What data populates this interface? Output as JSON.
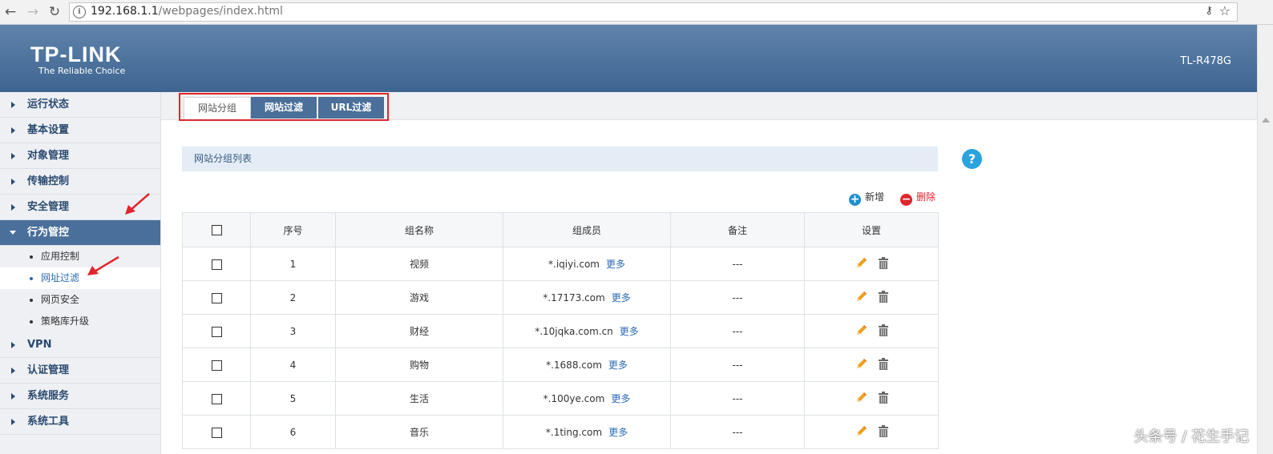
{
  "browser": {
    "url_host": "192.168.1.1",
    "url_path": "/webpages/index.html"
  },
  "header": {
    "logo": "TP-LINK",
    "tagline": "The Reliable Choice",
    "model": "TL-R478G"
  },
  "sidebar": {
    "items": [
      {
        "label": "运行状态"
      },
      {
        "label": "基本设置"
      },
      {
        "label": "对象管理"
      },
      {
        "label": "传输控制"
      },
      {
        "label": "安全管理"
      },
      {
        "label": "行为管控"
      }
    ],
    "subitems": [
      {
        "label": "应用控制"
      },
      {
        "label": "网址过滤"
      },
      {
        "label": "网页安全"
      },
      {
        "label": "策略库升级"
      }
    ],
    "items_after": [
      {
        "label": "VPN"
      },
      {
        "label": "认证管理"
      },
      {
        "label": "系统服务"
      },
      {
        "label": "系统工具"
      }
    ]
  },
  "tabs": [
    {
      "label": "网站分组"
    },
    {
      "label": "网站过滤"
    },
    {
      "label": "URL过滤"
    }
  ],
  "section": {
    "title": "网站分组列表",
    "help": "?",
    "add_label": "新增",
    "delete_label": "删除"
  },
  "table": {
    "headers": [
      "序号",
      "组名称",
      "组成员",
      "备注",
      "设置"
    ],
    "more_label": "更多",
    "rows": [
      {
        "index": "1",
        "name": "视频",
        "member": "*.iqiyi.com",
        "note": "---"
      },
      {
        "index": "2",
        "name": "游戏",
        "member": "*.17173.com",
        "note": "---"
      },
      {
        "index": "3",
        "name": "财经",
        "member": "*.10jqka.com.cn",
        "note": "---"
      },
      {
        "index": "4",
        "name": "购物",
        "member": "*.1688.com",
        "note": "---"
      },
      {
        "index": "5",
        "name": "生活",
        "member": "*.100ye.com",
        "note": "---"
      },
      {
        "index": "6",
        "name": "音乐",
        "member": "*.1ting.com",
        "note": "---"
      }
    ]
  },
  "watermark": "头条号 / 花生手记",
  "colors": {
    "header": "#4a6f9a",
    "accent_blue": "#2ba3dd",
    "highlight_red": "#e0262c"
  }
}
